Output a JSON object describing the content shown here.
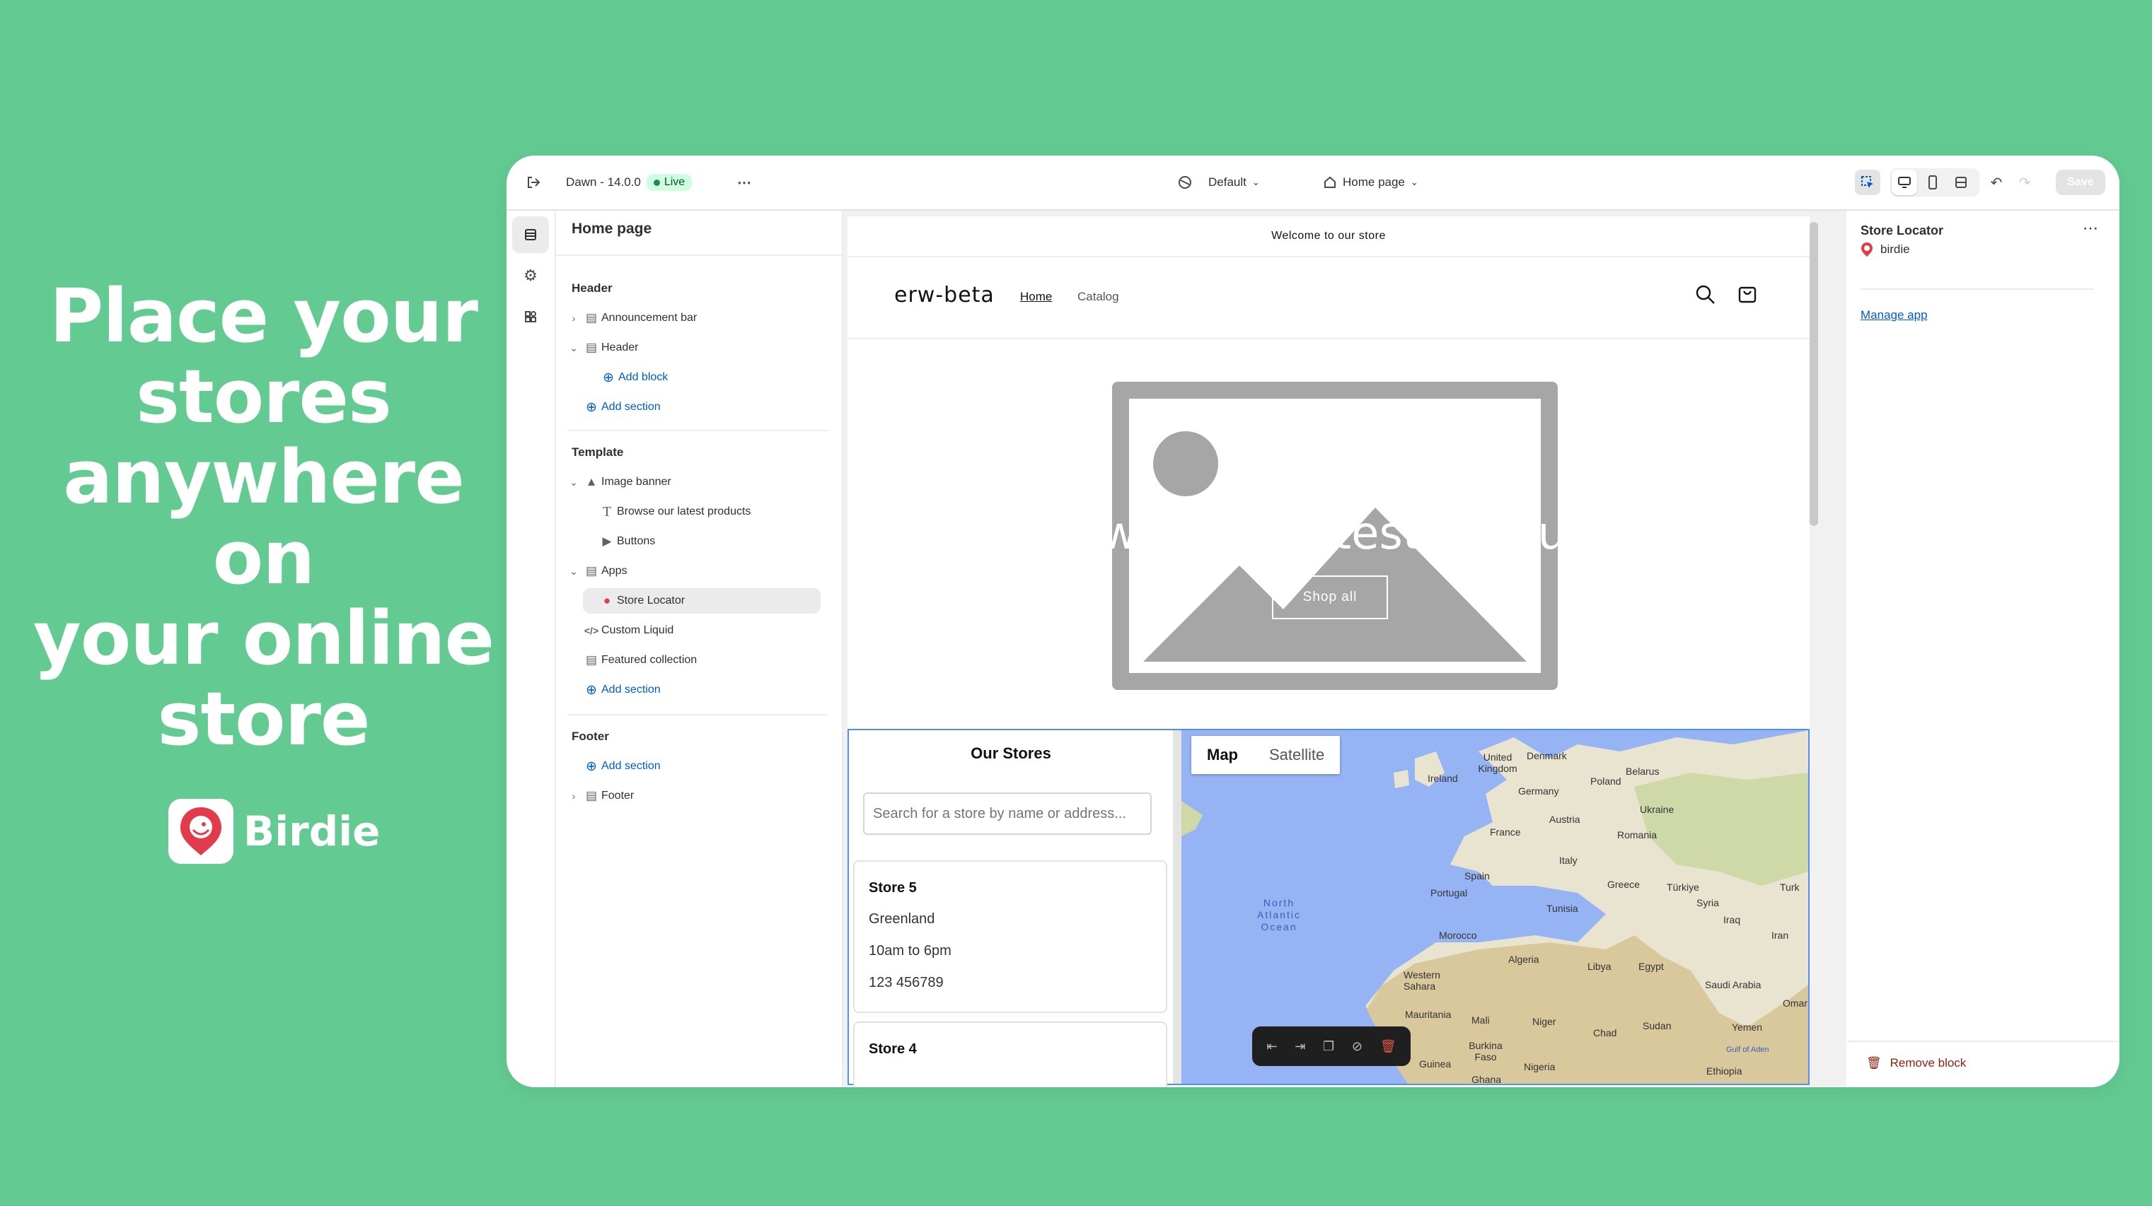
{
  "promo": {
    "headline_lines": [
      "Place your",
      "stores",
      "anywhere on",
      "your online",
      "store"
    ],
    "brand_name": "Birdie"
  },
  "topbar": {
    "theme_name": "Dawn - 14.0.0",
    "live_badge": "Live",
    "more": "⋯",
    "language": "Default",
    "page": "Home page",
    "save": "Save"
  },
  "sidebar": {
    "title": "Home page",
    "header_group": "Header",
    "items_header": [
      "Announcement bar",
      "Header"
    ],
    "add_block": "Add block",
    "add_section": "Add section",
    "template_group": "Template",
    "image_banner": "Image banner",
    "browse": "Browse our latest products",
    "buttons": "Buttons",
    "apps": "Apps",
    "store_locator": "Store Locator",
    "custom_liquid": "Custom Liquid",
    "featured": "Featured collection",
    "footer_group": "Footer",
    "footer": "Footer"
  },
  "preview": {
    "announcement": "Welcome to our store",
    "shop_name": "erw-beta",
    "nav": [
      "Home",
      "Catalog"
    ],
    "banner_text": "Browse our latest products",
    "shop_all": "Shop all",
    "stores_title": "Our Stores",
    "search_placeholder": "Search for a store by name or address...",
    "stores": [
      {
        "name": "Store 5",
        "location": "Greenland",
        "hours": "10am to 6pm",
        "phone": "123 456789"
      },
      {
        "name": "Store 4"
      }
    ],
    "map_tabs": [
      "Map",
      "Satellite"
    ],
    "map_labels": [
      "Denmark",
      "United Kingdom",
      "Belarus",
      "Ireland",
      "Poland",
      "Germany",
      "Ukraine",
      "Austria",
      "France",
      "Romania",
      "Italy",
      "Spain",
      "Portugal",
      "Greece",
      "Türkiye",
      "Turk",
      "Syria",
      "Tunisia",
      "Iraq",
      "North Atlantic Ocean",
      "Morocco",
      "Iran",
      "Algeria",
      "Libya",
      "Egypt",
      "Western Sahara",
      "Saudi Arabia",
      "Omar",
      "Mauritania",
      "Mali",
      "Niger",
      "Chad",
      "Sudan",
      "Yemen",
      "Burkina Faso",
      "Guinea",
      "Nigeria",
      "Ghana",
      "Ethiopia",
      "Gulf of Aden"
    ]
  },
  "right_panel": {
    "title": "Store Locator",
    "app_name": "birdie",
    "manage": "Manage app",
    "remove": "Remove block"
  },
  "colors": {
    "background": "#63cb92",
    "accent": "#005bd3",
    "danger": "#8e1f0b"
  }
}
